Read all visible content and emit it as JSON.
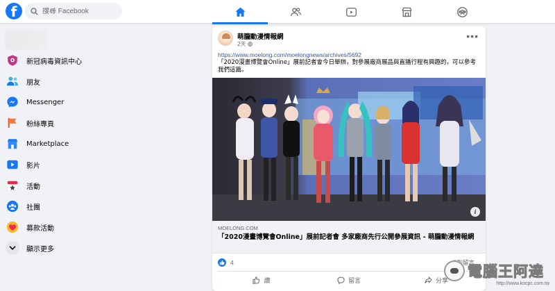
{
  "header": {
    "logo_letter": "f",
    "search_placeholder": "搜尋 Facebook",
    "tabs": [
      {
        "name": "home",
        "icon": "home-icon",
        "active": true
      },
      {
        "name": "friends",
        "icon": "friends-icon",
        "active": false
      },
      {
        "name": "watch",
        "icon": "watch-icon",
        "active": false
      },
      {
        "name": "marketplace",
        "icon": "marketplace-icon",
        "active": false
      },
      {
        "name": "groups",
        "icon": "groups-icon",
        "active": false
      }
    ]
  },
  "sidebar": {
    "items": [
      {
        "label": "新冠病毒資訊中心",
        "icon": "covid-info-icon"
      },
      {
        "label": "朋友",
        "icon": "friends-icon"
      },
      {
        "label": "Messenger",
        "icon": "messenger-icon"
      },
      {
        "label": "粉絲專頁",
        "icon": "pages-flag-icon"
      },
      {
        "label": "Marketplace",
        "icon": "marketplace-icon"
      },
      {
        "label": "影片",
        "icon": "video-icon"
      },
      {
        "label": "活動",
        "icon": "events-icon"
      },
      {
        "label": "社團",
        "icon": "groups-icon"
      },
      {
        "label": "募款活動",
        "icon": "fundraiser-icon"
      },
      {
        "label": "顯示更多",
        "icon": "chevron-down-icon"
      }
    ]
  },
  "post": {
    "page_name": "萌朧動漫情報網",
    "time": "2天",
    "privacy_icon": "globe-icon",
    "link": "https://www.moelong.com/moelongnews/archives/5692",
    "text": "「2020漫畫博覽會Online」展前記者會今日舉辦，對參展廠商展品與直播行程有興趣的，可以參考我們這篇。",
    "photo_info": "i",
    "link_domain": "MOELONG.COM",
    "link_title": "「2020漫畫博覽會Online」展前記者會 多家廠商先行公開參展資訊 - 萌朧動漫情報網",
    "reaction_count": "4",
    "comment_count": "2則留言",
    "actions": {
      "like": "讚",
      "comment": "留言",
      "share": "分享"
    }
  },
  "watermark": {
    "text": "電腦王阿達",
    "url": "http://www.kocpc.com.tw"
  },
  "colors": {
    "brand": "#1877f2",
    "background": "#f0f2f5",
    "link": "#385898",
    "secondary_text": "#65676b"
  }
}
